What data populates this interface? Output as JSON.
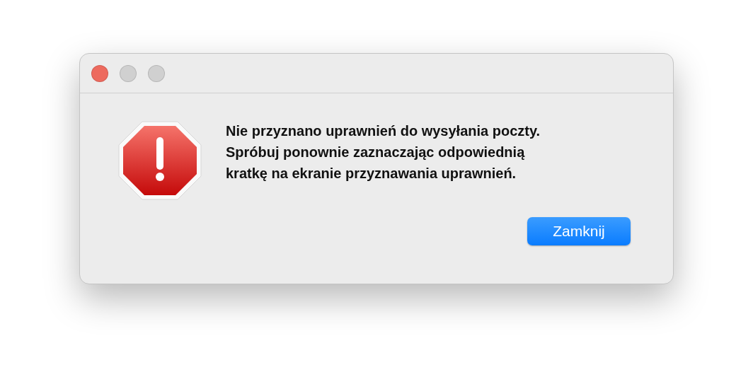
{
  "window": {
    "traffic_lights": [
      {
        "color": "#ed6a5e"
      },
      {
        "color": "#d0d0d0"
      },
      {
        "color": "#d0d0d0"
      }
    ]
  },
  "alert": {
    "kind": "stop",
    "message": "Nie przyznano uprawnień do wysyłania poczty.\nSpróbuj ponownie zaznaczając odpowiednią\nkratkę na ekranie przyznawania uprawnień.",
    "buttons": [
      {
        "label": "Zamknij",
        "default": true
      }
    ]
  }
}
